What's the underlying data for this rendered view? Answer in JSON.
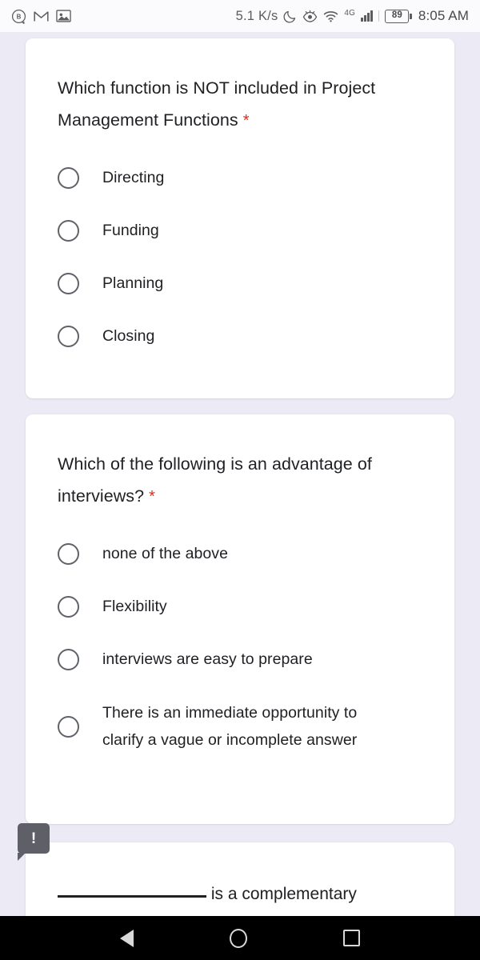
{
  "status_bar": {
    "left_icons": [
      "circled-b-icon",
      "gmail-m-icon",
      "photo-icon"
    ],
    "network_speed": "5.1 K/s",
    "right_icons": [
      "moon-icon",
      "eye-icon",
      "wifi-icon"
    ],
    "network_generation": "4G",
    "battery_level": "89",
    "time": "8:05 AM"
  },
  "form": {
    "questions": [
      {
        "title": "Which function is NOT included in Project Management Functions",
        "required_marker": "*",
        "options": [
          {
            "label": "Directing",
            "selected": false
          },
          {
            "label": "Funding",
            "selected": false
          },
          {
            "label": "Planning",
            "selected": false
          },
          {
            "label": "Closing",
            "selected": false
          }
        ]
      },
      {
        "title": "Which of the following is an advantage of interviews?",
        "required_marker": "*",
        "options": [
          {
            "label": "none of the above",
            "selected": false
          },
          {
            "label": "Flexibility",
            "selected": false
          },
          {
            "label": "interviews are easy to prepare",
            "selected": false
          },
          {
            "label": "There is an immediate opportunity to clarify a vague or incomplete answer",
            "selected": false
          }
        ]
      },
      {
        "title_suffix": "is a complementary",
        "blank": "__________________"
      }
    ]
  },
  "tooltip": {
    "icon": "exclamation-icon",
    "symbol": "!"
  },
  "nav_bar": {
    "back": "back-icon",
    "home": "home-icon",
    "recents": "recents-icon"
  },
  "colors": {
    "page_background": "#eceaf4",
    "card_background": "#ffffff",
    "text": "#202124",
    "required_star": "#d93025",
    "radio_border": "#5f6368",
    "tooltip_background": "#5f5f68",
    "nav_background": "#000000"
  }
}
